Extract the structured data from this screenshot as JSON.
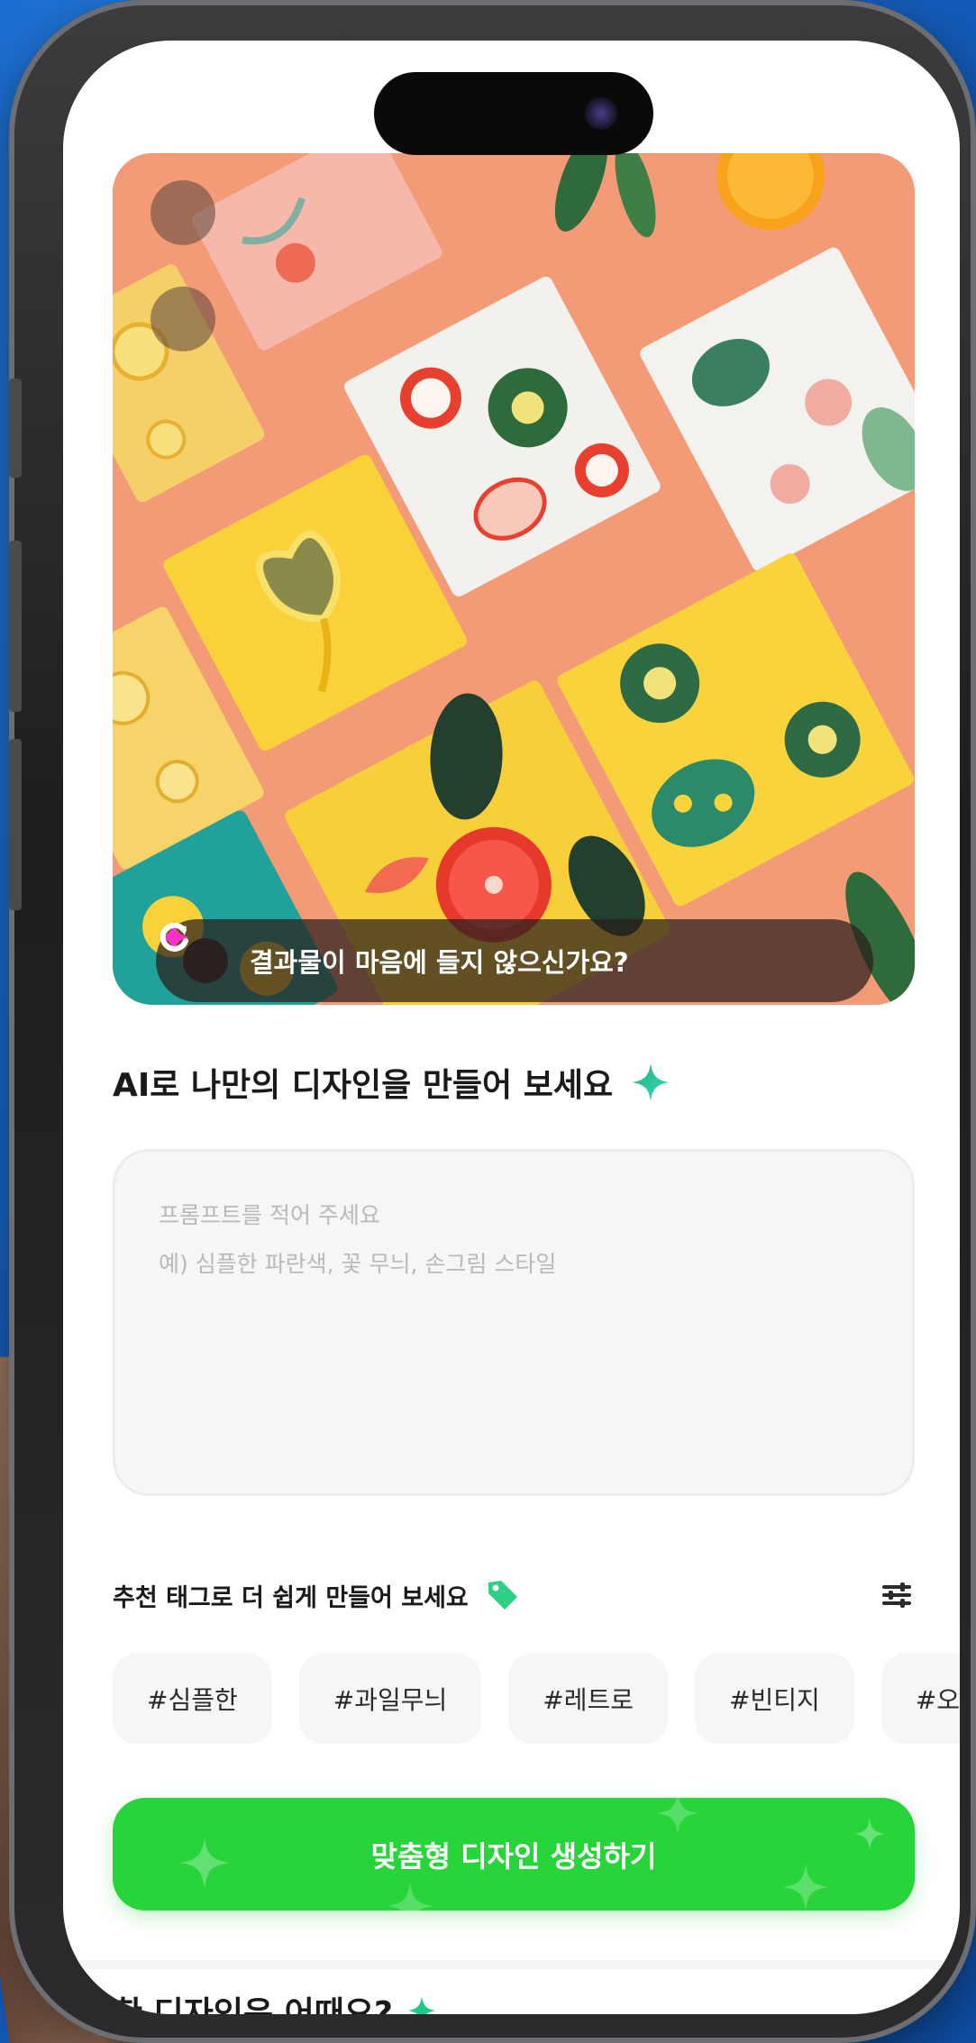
{
  "hero": {
    "regen_text": "결과물이 마음에 들지 않으신가요?",
    "regen_star_icon": "sparkle-icon",
    "regen_refresh_icon": "refresh-icon"
  },
  "create": {
    "headline": "AI로 나만의 디자인을 만들어 보세요",
    "headline_icon": "sparkle-icon",
    "prompt_placeholder_line1": "프롬프트를 적어 주세요",
    "prompt_placeholder_line2": "예) 심플한 파란색, 꽃 무늬, 손그림 스타일"
  },
  "tags": {
    "title": "추천 태그로 더 쉽게 만들어 보세요",
    "title_icon": "tag-icon",
    "filter_icon": "sliders-icon",
    "items": [
      "#심플한",
      "#과일무늬",
      "#레트로",
      "#빈티지",
      "#오렌"
    ]
  },
  "cta": {
    "label": "맞춤형 디자인 생성하기"
  },
  "next_section": {
    "title_partial": "한 디자인은 어때요?"
  },
  "colors": {
    "accent_green": "#27d53b",
    "hero_bg": "#f39a76",
    "sparkle_pink": "#ff2fc8",
    "sparkle_teal": "#1ec98c"
  }
}
